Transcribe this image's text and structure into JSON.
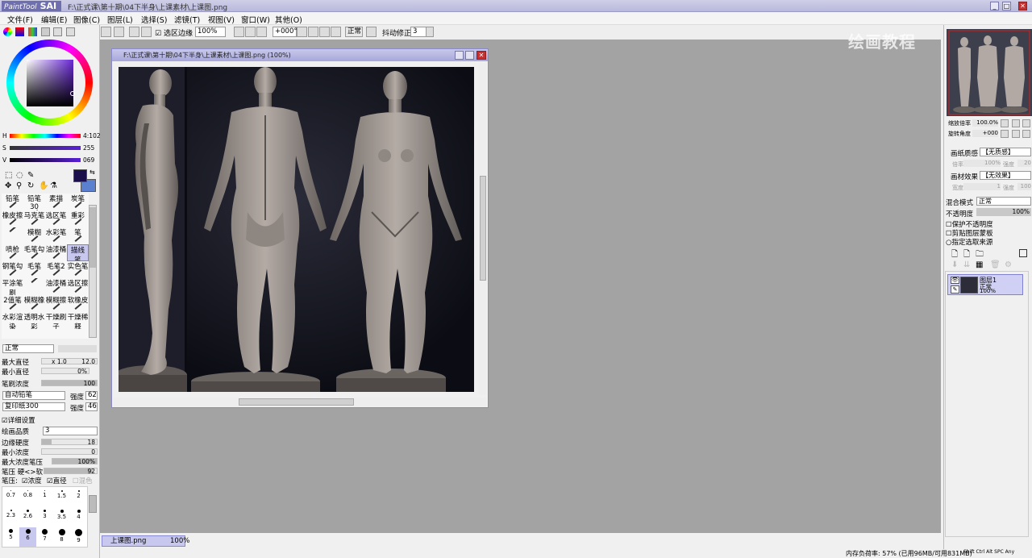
{
  "window": {
    "app_logo": "PaintTool SAI",
    "title": "F:\\正式课\\第十期\\04下半身\\上课素材\\上课图.png"
  },
  "menu": [
    "文件(F)",
    "编辑(E)",
    "图像(C)",
    "图层(L)",
    "选择(S)",
    "滤镜(T)",
    "视图(V)",
    "窗口(W)",
    "其他(O)"
  ],
  "toolbar": {
    "selection_edge_label": "选区边缘",
    "zoom": "100%",
    "rotation": "+000°",
    "blend_mode": "正常",
    "stabilizer_label": "抖动修正",
    "stabilizer_value": "3"
  },
  "color": {
    "h_label": "H",
    "h_value": "4:102",
    "s_label": "S",
    "s_value": "255",
    "v_label": "V",
    "v_value": "069",
    "fg": "#1a0f4a",
    "bg": "#5c80d0"
  },
  "tools": [
    [
      "铅笔",
      "铅笔30",
      "素描",
      "炭笔"
    ],
    [
      "橡皮擦",
      "马克笔",
      "选区笔",
      "重彩"
    ],
    [
      "",
      "模糊",
      "水彩笔",
      "笔"
    ],
    [
      "喷枪",
      "毛笔勾",
      "油漆桶",
      "描线笔"
    ],
    [
      "钢笔勾",
      "毛笔",
      "毛笔2",
      "实色笔"
    ],
    [
      "平涂笔刷",
      "",
      "油漆桶",
      "选区擦"
    ],
    [
      "2值笔",
      "模糊橡",
      "模糊擦",
      "软橡皮"
    ],
    [
      "水彩渲染",
      "透明水彩",
      "干燥刷子",
      "干燥稀释"
    ]
  ],
  "brush": {
    "mode": "正常",
    "max_size_label": "最大直径",
    "max_size_mult": "x 1.0",
    "max_size_value": "12.0",
    "min_size_label": "最小直径",
    "min_size_value": "0%",
    "density_label": "笔刷浓度",
    "density_value": "100",
    "shape_select": "自动铅笔",
    "shape_strength_label": "强度",
    "shape_strength": "62",
    "texture_select": "复印纸300",
    "texture_strength_label": "强度",
    "texture_strength": "46",
    "advanced_label": "详细设置",
    "quality_label": "绘画品质",
    "quality_value": "3",
    "edge_label": "边缘硬度",
    "edge_value": "18",
    "min_density_label": "最小浓度",
    "min_density_value": "0",
    "max_pressure_label": "最大浓度笔压",
    "max_pressure_value": "100%",
    "pressure_label": "笔压  硬<>软",
    "pressure_value": "92",
    "pressure_opts_label": "笔压:",
    "opt_density": "浓度",
    "opt_size": "直径",
    "opt_blend": "混色"
  },
  "brush_sizes": [
    "0.7",
    "0.8",
    "1",
    "1.5",
    "2",
    "2.3",
    "2.6",
    "3",
    "3.5",
    "4",
    "5",
    "6",
    "7",
    "8",
    "9"
  ],
  "document": {
    "title": "F:\\正式课\\第十期\\04下半身\\上课素材\\上课图.png (100%)",
    "tab": "上课图.png",
    "tab_zoom": "100%"
  },
  "navigator": {
    "zoom_label": "缩放倍率",
    "zoom_value": "100.0%",
    "angle_label": "旋转角度",
    "angle_value": "+000"
  },
  "layer_panel": {
    "paper_texture_label": "画纸质感",
    "paper_texture_value": "【无质感】",
    "scale_label": "倍率",
    "scale_value": "100%",
    "intensity_label": "强度",
    "intensity_value": "20",
    "paper_effect_label": "画材效果",
    "paper_effect_value": "【无效果】",
    "width_label": "宽度",
    "width_value": "1",
    "intensity2_value": "100",
    "blend_label": "混合模式",
    "blend_value": "正常",
    "opacity_label": "不透明度",
    "opacity_value": "100%",
    "protect_alpha": "保护不透明度",
    "clip_group": "剪贴图层蒙板",
    "selection_source": "指定选取来源",
    "layer_name": "图层1",
    "layer_mode": "正常",
    "layer_opacity": "100%"
  },
  "status": {
    "memory": "内存负荷率: 57% (已用96MB/可用831MB)",
    "keys": "Shift Ctrl Alt SPC Any"
  },
  "watermark": "绘画教程"
}
